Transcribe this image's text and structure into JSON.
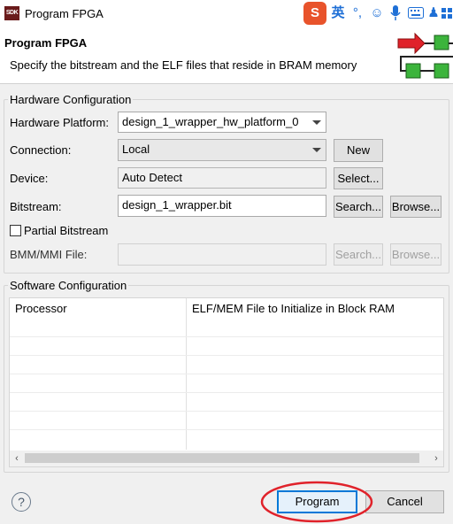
{
  "window": {
    "title": "Program FPGA",
    "app_icon": "SDK"
  },
  "ime": {
    "brand": "S",
    "lang": "英",
    "items": [
      "punctuation-icon",
      "emoji-icon",
      "mic-icon",
      "keyboard-icon",
      "clothes-icon",
      "grid-icon"
    ]
  },
  "header": {
    "title": "Program FPGA",
    "description": "Specify the bitstream and the ELF files that reside in BRAM memory"
  },
  "hardware": {
    "group_title": "Hardware Configuration",
    "platform_label": "Hardware Platform:",
    "platform_value": "design_1_wrapper_hw_platform_0",
    "connection_label": "Connection:",
    "connection_value": "Local",
    "new_button": "New",
    "device_label": "Device:",
    "device_value": "Auto Detect",
    "select_button": "Select...",
    "bitstream_label": "Bitstream:",
    "bitstream_value": "design_1_wrapper.bit",
    "search_button": "Search...",
    "browse_button": "Browse...",
    "partial_label": "Partial Bitstream",
    "bmm_label": "BMM/MMI File:",
    "bmm_search_button": "Search...",
    "bmm_browse_button": "Browse..."
  },
  "software": {
    "group_title": "Software Configuration",
    "columns": [
      "Processor",
      "ELF/MEM File to Initialize in Block RAM"
    ]
  },
  "footer": {
    "program_button": "Program",
    "cancel_button": "Cancel"
  },
  "colors": {
    "annotation_circle": "#e0222a",
    "header_arrow": "#e0222a",
    "header_block": "#3cb43c"
  }
}
